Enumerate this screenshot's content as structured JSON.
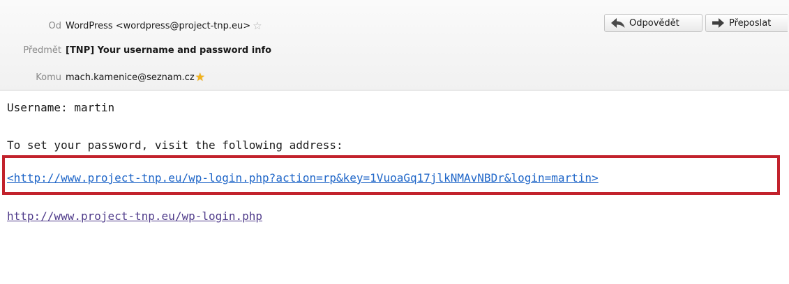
{
  "header": {
    "from": {
      "label": "Od",
      "value": "WordPress <wordpress@project-tnp.eu>",
      "star_icon": "star-outline-icon"
    },
    "subject": {
      "label": "Předmět",
      "value": "[TNP] Your username and password info"
    },
    "to": {
      "label": "Komu",
      "value": "mach.kamenice@seznam.cz",
      "star_icon": "star-filled-icon"
    }
  },
  "toolbar": {
    "reply_label": "Odpovědět",
    "reply_icon": "reply-arrow-icon",
    "forward_label": "Přeposlat",
    "forward_icon": "forward-arrow-icon"
  },
  "message": {
    "line1": "Username: martin",
    "line2": "To set your password, visit the following address:",
    "reset_link": "<http://www.project-tnp.eu/wp-login.php?action=rp&key=1VuoaGq17jlkNMAvNBDr&login=martin>",
    "login_link": "http://www.project-tnp.eu/wp-login.php"
  },
  "colors": {
    "highlight_border": "#c2222c",
    "link": "#1f66c8",
    "visited_link": "#4f3b8a",
    "star_gold": "#f2b21a"
  }
}
